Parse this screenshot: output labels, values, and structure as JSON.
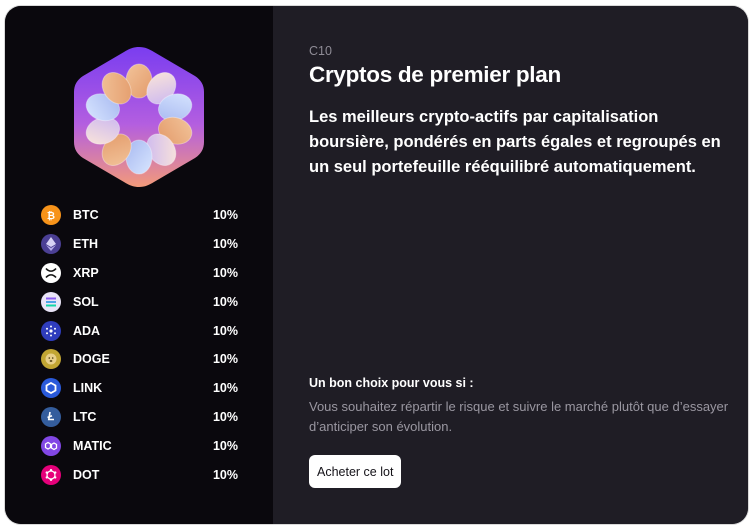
{
  "bundle": {
    "code": "C10",
    "title": "Cryptos de premier plan",
    "description": "Les meilleurs crypto-actifs par capitalisation boursière, pondérés en parts égales et regroupés en un seul portefeuille rééquilibré automatiquement.",
    "fit_title": "Un bon choix pour vous si :",
    "fit_text": "Vous souhaitez répartir le risque et suivre le marché plutôt que d’essayer d’anticiper son évolution.",
    "buy_label": "Acheter ce lot"
  },
  "assets": [
    {
      "ticker": "BTC",
      "weight": "10%",
      "icon": "bitcoin-icon",
      "color": "#f7931a"
    },
    {
      "ticker": "ETH",
      "weight": "10%",
      "icon": "ethereum-icon",
      "color": "#4b3f94"
    },
    {
      "ticker": "XRP",
      "weight": "10%",
      "icon": "xrp-icon",
      "color": "#ffffff"
    },
    {
      "ticker": "SOL",
      "weight": "10%",
      "icon": "solana-icon",
      "color": "#e9e4f7"
    },
    {
      "ticker": "ADA",
      "weight": "10%",
      "icon": "cardano-icon",
      "color": "#2f3dbd"
    },
    {
      "ticker": "DOGE",
      "weight": "10%",
      "icon": "dogecoin-icon",
      "color": "#c2a633"
    },
    {
      "ticker": "LINK",
      "weight": "10%",
      "icon": "chainlink-icon",
      "color": "#2a5ada"
    },
    {
      "ticker": "LTC",
      "weight": "10%",
      "icon": "litecoin-icon",
      "color": "#345d9d"
    },
    {
      "ticker": "MATIC",
      "weight": "10%",
      "icon": "polygon-icon",
      "color": "#8247e5"
    },
    {
      "ticker": "DOT",
      "weight": "10%",
      "icon": "polkadot-icon",
      "color": "#e6007a"
    }
  ]
}
